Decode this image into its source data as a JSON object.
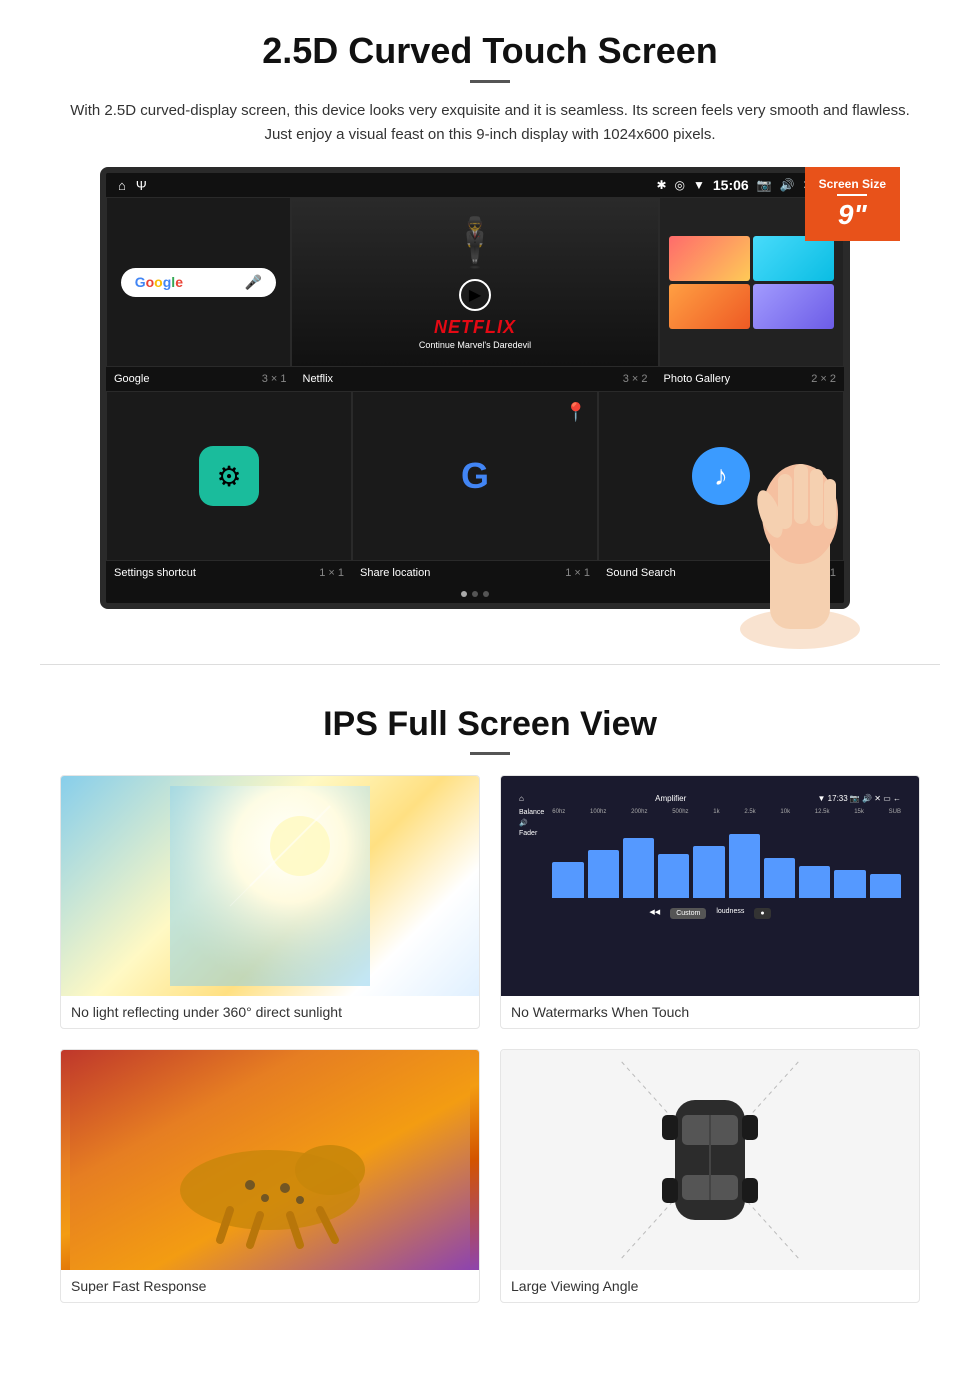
{
  "section1": {
    "title": "2.5D Curved Touch Screen",
    "subtitle": "With 2.5D curved-display screen, this device looks very exquisite and it is seamless. Its screen feels very smooth and flawless. Just enjoy a visual feast on this 9-inch display with 1024x600 pixels.",
    "screen_badge": {
      "label": "Screen Size",
      "size": "9\""
    },
    "status_bar": {
      "time": "15:06"
    },
    "apps": [
      {
        "name": "Google",
        "size": "3 × 1"
      },
      {
        "name": "Netflix",
        "size": "3 × 2",
        "subtitle": "Continue Marvel's Daredevil"
      },
      {
        "name": "Photo Gallery",
        "size": "2 × 2"
      },
      {
        "name": "Settings shortcut",
        "size": "1 × 1"
      },
      {
        "name": "Share location",
        "size": "1 × 1"
      },
      {
        "name": "Sound Search",
        "size": "1 × 1"
      }
    ]
  },
  "section2": {
    "title": "IPS Full Screen View",
    "divider_label": "—",
    "features": [
      {
        "id": "sunlight",
        "caption": "No light reflecting under 360° direct sunlight"
      },
      {
        "id": "amplifier",
        "caption": "No Watermarks When Touch"
      },
      {
        "id": "cheetah",
        "caption": "Super Fast Response"
      },
      {
        "id": "car",
        "caption": "Large Viewing Angle"
      }
    ]
  }
}
